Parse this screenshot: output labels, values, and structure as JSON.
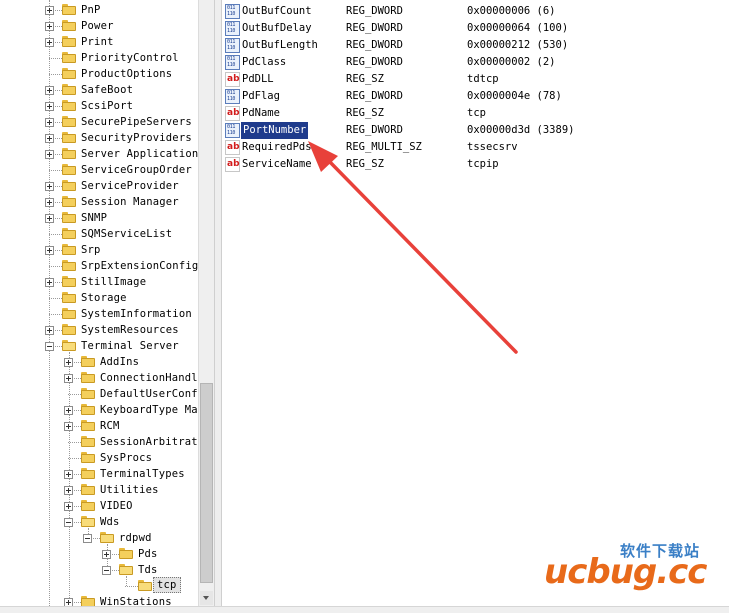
{
  "tree": {
    "items": [
      {
        "label": "PnP",
        "depth": 0,
        "expander": "plus"
      },
      {
        "label": "Power",
        "depth": 0,
        "expander": "plus"
      },
      {
        "label": "Print",
        "depth": 0,
        "expander": "plus"
      },
      {
        "label": "PriorityControl",
        "depth": 0,
        "expander": "none"
      },
      {
        "label": "ProductOptions",
        "depth": 0,
        "expander": "none"
      },
      {
        "label": "SafeBoot",
        "depth": 0,
        "expander": "plus"
      },
      {
        "label": "ScsiPort",
        "depth": 0,
        "expander": "plus"
      },
      {
        "label": "SecurePipeServers",
        "depth": 0,
        "expander": "plus"
      },
      {
        "label": "SecurityProviders",
        "depth": 0,
        "expander": "plus"
      },
      {
        "label": "Server Applications",
        "depth": 0,
        "expander": "plus"
      },
      {
        "label": "ServiceGroupOrder",
        "depth": 0,
        "expander": "none"
      },
      {
        "label": "ServiceProvider",
        "depth": 0,
        "expander": "plus"
      },
      {
        "label": "Session Manager",
        "depth": 0,
        "expander": "plus"
      },
      {
        "label": "SNMP",
        "depth": 0,
        "expander": "plus"
      },
      {
        "label": "SQMServiceList",
        "depth": 0,
        "expander": "none"
      },
      {
        "label": "Srp",
        "depth": 0,
        "expander": "plus"
      },
      {
        "label": "SrpExtensionConfig",
        "depth": 0,
        "expander": "none"
      },
      {
        "label": "StillImage",
        "depth": 0,
        "expander": "plus"
      },
      {
        "label": "Storage",
        "depth": 0,
        "expander": "none"
      },
      {
        "label": "SystemInformation",
        "depth": 0,
        "expander": "none"
      },
      {
        "label": "SystemResources",
        "depth": 0,
        "expander": "plus"
      },
      {
        "label": "Terminal Server",
        "depth": 0,
        "expander": "minus",
        "open": true
      },
      {
        "label": "AddIns",
        "depth": 1,
        "expander": "plus"
      },
      {
        "label": "ConnectionHandle",
        "depth": 1,
        "expander": "plus"
      },
      {
        "label": "DefaultUserConfi",
        "depth": 1,
        "expander": "none"
      },
      {
        "label": "KeyboardType Map",
        "depth": 1,
        "expander": "plus"
      },
      {
        "label": "RCM",
        "depth": 1,
        "expander": "plus"
      },
      {
        "label": "SessionArbitrati",
        "depth": 1,
        "expander": "none"
      },
      {
        "label": "SysProcs",
        "depth": 1,
        "expander": "none"
      },
      {
        "label": "TerminalTypes",
        "depth": 1,
        "expander": "plus"
      },
      {
        "label": "Utilities",
        "depth": 1,
        "expander": "plus"
      },
      {
        "label": "VIDEO",
        "depth": 1,
        "expander": "plus"
      },
      {
        "label": "Wds",
        "depth": 1,
        "expander": "minus",
        "open": true
      },
      {
        "label": "rdpwd",
        "depth": 2,
        "expander": "minus",
        "open": true
      },
      {
        "label": "Pds",
        "depth": 3,
        "expander": "plus"
      },
      {
        "label": "Tds",
        "depth": 3,
        "expander": "minus",
        "open": true
      },
      {
        "label": "tcp",
        "depth": 4,
        "expander": "none",
        "selected": true,
        "open": true
      },
      {
        "label": "WinStations",
        "depth": 1,
        "expander": "plus"
      }
    ]
  },
  "values": {
    "rows": [
      {
        "icon": "binary-value-icon",
        "name": "OutBufCount",
        "type": "REG_DWORD",
        "data": "0x00000006 (6)"
      },
      {
        "icon": "binary-value-icon",
        "name": "OutBufDelay",
        "type": "REG_DWORD",
        "data": "0x00000064 (100)"
      },
      {
        "icon": "binary-value-icon",
        "name": "OutBufLength",
        "type": "REG_DWORD",
        "data": "0x00000212 (530)"
      },
      {
        "icon": "binary-value-icon",
        "name": "PdClass",
        "type": "REG_DWORD",
        "data": "0x00000002 (2)"
      },
      {
        "icon": "string-value-icon",
        "name": "PdDLL",
        "type": "REG_SZ",
        "data": "tdtcp"
      },
      {
        "icon": "binary-value-icon",
        "name": "PdFlag",
        "type": "REG_DWORD",
        "data": "0x0000004e (78)"
      },
      {
        "icon": "string-value-icon",
        "name": "PdName",
        "type": "REG_SZ",
        "data": "tcp"
      },
      {
        "icon": "binary-value-icon",
        "name": "PortNumber",
        "type": "REG_DWORD",
        "data": "0x00000d3d (3389)",
        "selected": true
      },
      {
        "icon": "string-value-icon",
        "name": "RequiredPds",
        "type": "REG_MULTI_SZ",
        "data": "tssecsrv"
      },
      {
        "icon": "string-value-icon",
        "name": "ServiceName",
        "type": "REG_SZ",
        "data": "tcpip"
      }
    ],
    "string_icon_text": "ab"
  },
  "annotation": {
    "color": "#e8413a"
  },
  "watermark": {
    "main": "ucbug.cc",
    "sub": "软件下载站"
  }
}
